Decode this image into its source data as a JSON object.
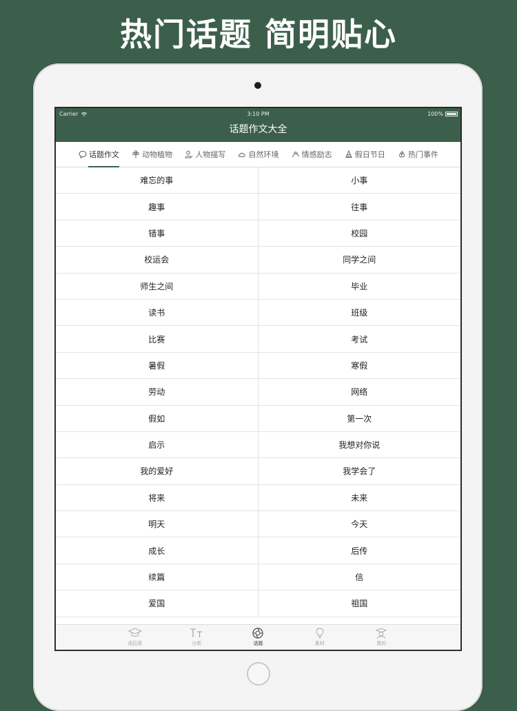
{
  "headline": "热门话题 简明贴心",
  "status_bar": {
    "carrier": "Carrier",
    "time": "3:10 PM",
    "battery": "100%"
  },
  "nav_title": "话题作文大全",
  "tabs": [
    {
      "label": "话题作文",
      "icon": "speech-bubble-icon",
      "active": true
    },
    {
      "label": "动物植物",
      "icon": "flower-icon",
      "active": false
    },
    {
      "label": "人物描写",
      "icon": "person-icon",
      "active": false
    },
    {
      "label": "自然环境",
      "icon": "cloud-icon",
      "active": false
    },
    {
      "label": "情感励志",
      "icon": "hands-icon",
      "active": false
    },
    {
      "label": "假日节日",
      "icon": "party-hat-icon",
      "active": false
    },
    {
      "label": "热门事件",
      "icon": "fire-icon",
      "active": false
    }
  ],
  "topics": [
    [
      "难忘的事",
      "小事"
    ],
    [
      "趣事",
      "往事"
    ],
    [
      "错事",
      "校园"
    ],
    [
      "校运会",
      "同学之间"
    ],
    [
      "师生之间",
      "毕业"
    ],
    [
      "读书",
      "班级"
    ],
    [
      "比赛",
      "考试"
    ],
    [
      "暑假",
      "寒假"
    ],
    [
      "劳动",
      "网络"
    ],
    [
      "假如",
      "第一次"
    ],
    [
      "启示",
      "我想对你说"
    ],
    [
      "我的爱好",
      "我学会了"
    ],
    [
      "将来",
      "未来"
    ],
    [
      "明天",
      "今天"
    ],
    [
      "成长",
      "后传"
    ],
    [
      "续篇",
      "信"
    ],
    [
      "爱国",
      "祖国"
    ]
  ],
  "bottom_nav": [
    {
      "label": "读后感",
      "icon": "graduation-cap-icon",
      "active": false
    },
    {
      "label": "分类",
      "icon": "text-size-icon",
      "active": false
    },
    {
      "label": "话题",
      "icon": "aperture-icon",
      "active": true
    },
    {
      "label": "素材",
      "icon": "lightbulb-icon",
      "active": false
    },
    {
      "label": "我的",
      "icon": "user-cap-icon",
      "active": false
    }
  ]
}
